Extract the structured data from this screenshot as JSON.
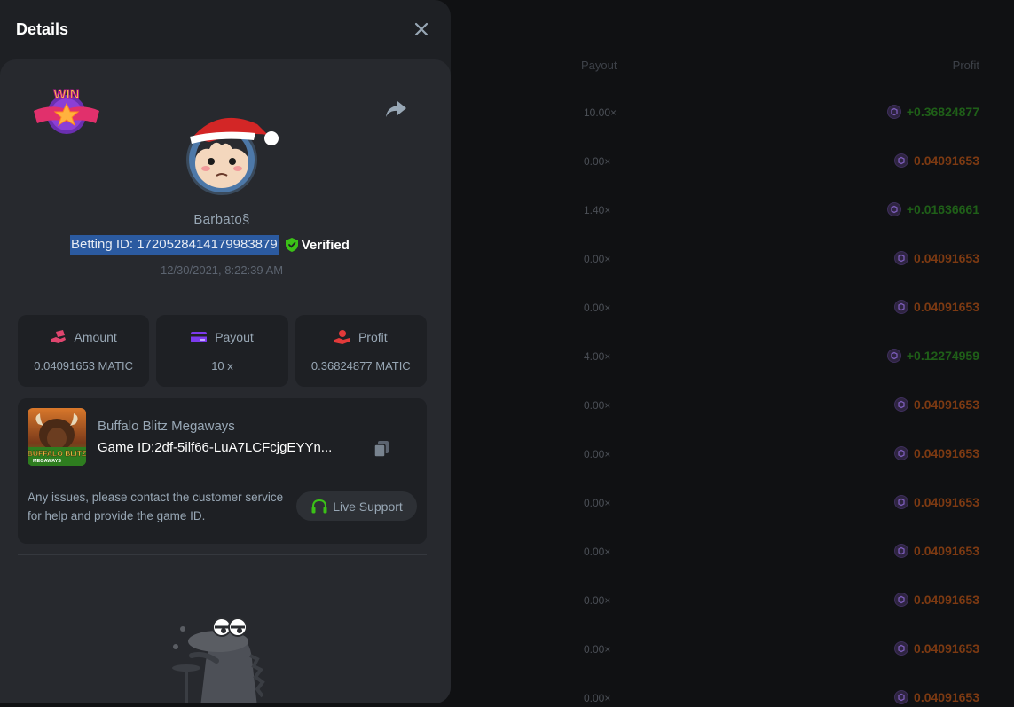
{
  "panel": {
    "title": "Details",
    "username": "Barbato§",
    "betting_id": "Betting ID: 1720528414179983879",
    "verified_label": "Verified",
    "timestamp": "12/30/2021, 8:22:39 AM",
    "win_badge_text": "WIN",
    "stats": [
      {
        "label": "Amount",
        "value": "0.04091653 MATIC",
        "icon": "money-hand-icon",
        "color": "#e0466f"
      },
      {
        "label": "Payout",
        "value": "10 x",
        "icon": "card-icon",
        "color": "#7c3aed"
      },
      {
        "label": "Profit",
        "value": "0.36824877 MATIC",
        "icon": "profit-hand-icon",
        "color": "#e23a3a"
      }
    ],
    "game": {
      "name": "Buffalo Blitz Megaways",
      "id_label": "Game ID:",
      "id_value": "2df-5ilf66-LuA7LCFcjgEYYn...",
      "thumb_title": "BUFFALO BLITZ",
      "thumb_subtitle": "MEGAWAYS"
    },
    "support_text": "Any issues, please contact the customer service for help and provide the game ID.",
    "live_support_label": "Live Support"
  },
  "table": {
    "headers": {
      "payout": "Payout",
      "profit": "Profit"
    },
    "rows": [
      {
        "payout": "10.00×",
        "profit": "+0.36824877",
        "win": true
      },
      {
        "payout": "0.00×",
        "profit": "0.04091653",
        "win": false
      },
      {
        "payout": "1.40×",
        "profit": "+0.01636661",
        "win": true
      },
      {
        "payout": "0.00×",
        "profit": "0.04091653",
        "win": false
      },
      {
        "payout": "0.00×",
        "profit": "0.04091653",
        "win": false
      },
      {
        "payout": "4.00×",
        "profit": "+0.12274959",
        "win": true
      },
      {
        "payout": "0.00×",
        "profit": "0.04091653",
        "win": false
      },
      {
        "payout": "0.00×",
        "profit": "0.04091653",
        "win": false
      },
      {
        "payout": "0.00×",
        "profit": "0.04091653",
        "win": false
      },
      {
        "payout": "0.00×",
        "profit": "0.04091653",
        "win": false
      },
      {
        "payout": "0.00×",
        "profit": "0.04091653",
        "win": false
      },
      {
        "payout": "0.00×",
        "profit": "0.04091653",
        "win": false
      },
      {
        "payout": "0.00×",
        "profit": "0.04091653",
        "win": false
      }
    ]
  },
  "colors": {
    "panel_bg": "#1e2024",
    "card_bg": "#27292e",
    "accent_green": "#3bc117",
    "highlight": "#2b5aa0"
  }
}
